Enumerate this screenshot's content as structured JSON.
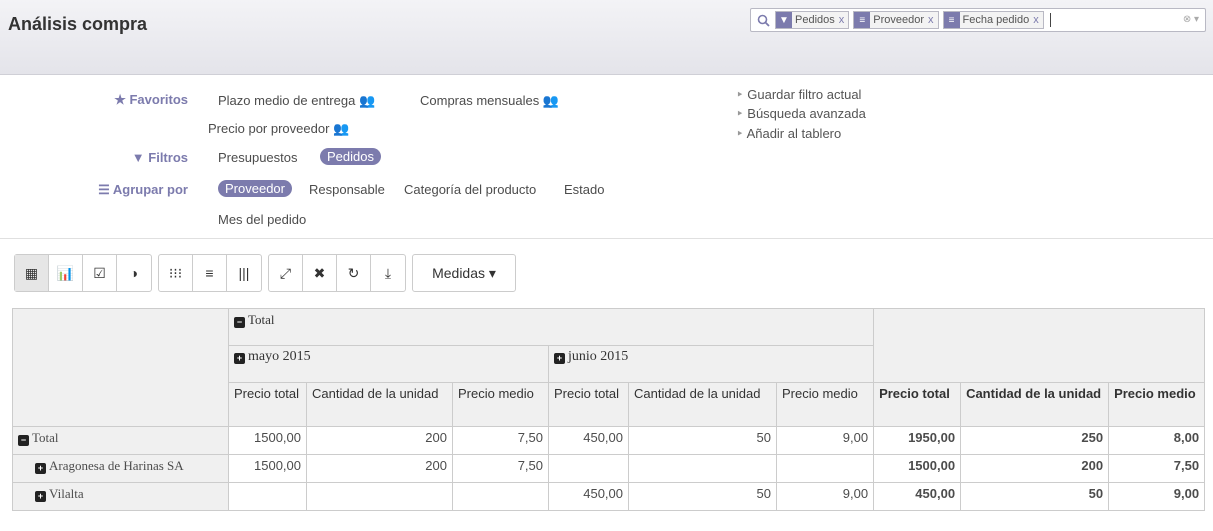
{
  "header": {
    "title": "Análisis compra",
    "search_facets": [
      {
        "icon": "filter-icon",
        "label": "Pedidos",
        "remove": "x"
      },
      {
        "icon": "group-icon",
        "label": "Proveedor",
        "remove": "x"
      },
      {
        "icon": "group-icon",
        "label": "Fecha pedido",
        "remove": "x"
      }
    ]
  },
  "filters": {
    "favoritos_label": "Favoritos",
    "favoritos": [
      "Plazo medio de entrega",
      "Compras mensuales",
      "Precio por proveedor"
    ],
    "filtros_label": "Filtros",
    "filtros": [
      "Presupuestos",
      "Pedidos"
    ],
    "agrupar_label": "Agrupar por",
    "agrupar": [
      "Proveedor",
      "Responsable",
      "Categoría del producto",
      "Estado",
      "Mes del pedido"
    ],
    "side_options": [
      "Guardar filtro actual",
      "Búsqueda avanzada",
      "Añadir al tablero"
    ]
  },
  "toolbar": {
    "medidas_label": "Medidas"
  },
  "pivot": {
    "total_label": "Total",
    "col_groups": [
      "mayo 2015",
      "junio 2015"
    ],
    "measures": [
      "Precio total",
      "Cantidad de la unidad",
      "Precio medio"
    ],
    "rows": [
      {
        "label": "Total",
        "values": [
          "1500,00",
          "200",
          "7,50",
          "450,00",
          "50",
          "9,00",
          "1950,00",
          "250",
          "8,00"
        ]
      },
      {
        "label": "Aragonesa de Harinas SA",
        "values": [
          "1500,00",
          "200",
          "7,50",
          "",
          "",
          "",
          "1500,00",
          "200",
          "7,50"
        ]
      },
      {
        "label": "Vilalta",
        "values": [
          "",
          "",
          "",
          "450,00",
          "50",
          "9,00",
          "450,00",
          "50",
          "9,00"
        ]
      }
    ]
  },
  "colors": {
    "accent": "#7c7bad"
  }
}
